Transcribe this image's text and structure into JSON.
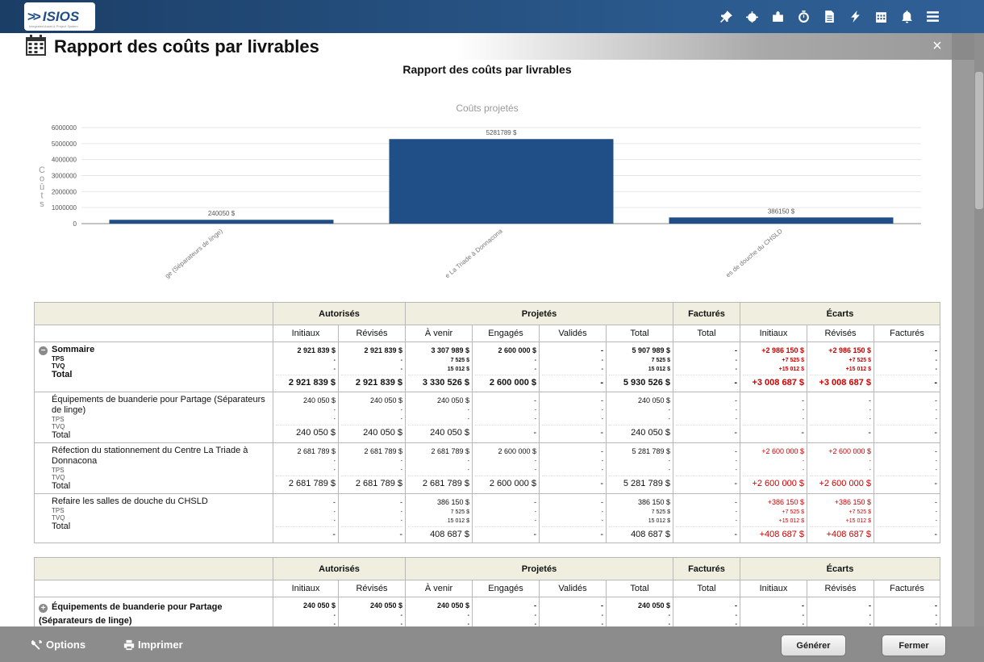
{
  "app": {
    "name": "ISIOS",
    "tagline": "Integrated Asset & Project System"
  },
  "page_title": "Rapport des coûts par livrables",
  "close_label": "×",
  "report_title": "Rapport des coûts par livrables",
  "chart_data": {
    "type": "bar",
    "title": "Coûts projetés",
    "ylabel": "Coûts",
    "ylim": [
      0,
      6000000
    ],
    "yticks": [
      "0",
      "1000000",
      "2000000",
      "3000000",
      "4000000",
      "5000000",
      "6000000"
    ],
    "categories": [
      "ge (Séparateurs de linge)",
      "e La Triade à Donnacona",
      "es de douche du CHSLD"
    ],
    "values": [
      240050,
      5281789,
      386150
    ],
    "data_labels": [
      "240050 $",
      "5281789 $",
      "386150 $"
    ],
    "bar_color": "#1f4f86"
  },
  "table_headers": {
    "groups": [
      "Autorisés",
      "Projetés",
      "Facturés",
      "Écarts"
    ],
    "cols": [
      "Initiaux",
      "Révisés",
      "À venir",
      "Engagés",
      "Validés",
      "Total",
      "Total",
      "Initiaux",
      "Révisés",
      "Facturés"
    ]
  },
  "rows": [
    {
      "name": "Sommaire",
      "sub": [
        "TPS",
        "TVQ"
      ],
      "total_label": "Total",
      "bold": true,
      "expander": "−",
      "cells": [
        {
          "v": [
            "2 921 839 $",
            "-",
            "-"
          ],
          "t": "2 921 839 $"
        },
        {
          "v": [
            "2 921 839 $",
            "-",
            "-"
          ],
          "t": "2 921 839 $"
        },
        {
          "v": [
            "3 307 989 $",
            "7 525 $",
            "15 012 $"
          ],
          "t": "3 330 526 $"
        },
        {
          "v": [
            "2 600 000 $",
            "-",
            "-"
          ],
          "t": "2 600 000 $"
        },
        {
          "v": [
            "-",
            "-",
            "-"
          ],
          "t": "-"
        },
        {
          "v": [
            "5 907 989 $",
            "7 525 $",
            "15 012 $"
          ],
          "t": "5 930 526 $"
        },
        {
          "v": [
            "-",
            "-",
            "-"
          ],
          "t": "-"
        },
        {
          "v": [
            "+2 986 150 $",
            "+7 525 $",
            "+15 012 $"
          ],
          "t": "+3 008 687 $",
          "red": true
        },
        {
          "v": [
            "+2 986 150 $",
            "+7 525 $",
            "+15 012 $"
          ],
          "t": "+3 008 687 $",
          "red": true
        },
        {
          "v": [
            "-",
            "-",
            "-"
          ],
          "t": "-"
        }
      ]
    },
    {
      "name": "Équipements de buanderie pour Partage (Séparateurs de linge)",
      "sub": [
        "TPS",
        "TVQ"
      ],
      "total_label": "Total",
      "cells": [
        {
          "v": [
            "240 050 $",
            "-",
            "-"
          ],
          "t": "240 050 $"
        },
        {
          "v": [
            "240 050 $",
            "-",
            "-"
          ],
          "t": "240 050 $"
        },
        {
          "v": [
            "240 050 $",
            "-",
            "-"
          ],
          "t": "240 050 $"
        },
        {
          "v": [
            "-",
            "-",
            "-"
          ],
          "t": "-"
        },
        {
          "v": [
            "-",
            "-",
            "-"
          ],
          "t": "-"
        },
        {
          "v": [
            "240 050 $",
            "-",
            "-"
          ],
          "t": "240 050 $"
        },
        {
          "v": [
            "-",
            "-",
            "-"
          ],
          "t": "-"
        },
        {
          "v": [
            "-",
            "-",
            "-"
          ],
          "t": "-"
        },
        {
          "v": [
            "-",
            "-",
            "-"
          ],
          "t": "-"
        },
        {
          "v": [
            "-",
            "-",
            "-"
          ],
          "t": "-"
        }
      ]
    },
    {
      "name": "Réfection du stationnement du Centre La Triade à Donnacona",
      "sub": [
        "TPS",
        "TVQ"
      ],
      "total_label": "Total",
      "cells": [
        {
          "v": [
            "2 681 789 $",
            "-",
            "-"
          ],
          "t": "2 681 789 $"
        },
        {
          "v": [
            "2 681 789 $",
            "-",
            "-"
          ],
          "t": "2 681 789 $"
        },
        {
          "v": [
            "2 681 789 $",
            "-",
            "-"
          ],
          "t": "2 681 789 $"
        },
        {
          "v": [
            "2 600 000 $",
            "-",
            "-"
          ],
          "t": "2 600 000 $"
        },
        {
          "v": [
            "-",
            "-",
            "-"
          ],
          "t": "-"
        },
        {
          "v": [
            "5 281 789 $",
            "-",
            "-"
          ],
          "t": "5 281 789 $"
        },
        {
          "v": [
            "-",
            "-",
            "-"
          ],
          "t": "-"
        },
        {
          "v": [
            "+2 600 000 $",
            "-",
            "-"
          ],
          "t": "+2 600 000 $",
          "red": true
        },
        {
          "v": [
            "+2 600 000 $",
            "-",
            "-"
          ],
          "t": "+2 600 000 $",
          "red": true
        },
        {
          "v": [
            "-",
            "-",
            "-"
          ],
          "t": "-"
        }
      ]
    },
    {
      "name": "Refaire les salles de douche du CHSLD",
      "sub": [
        "TPS",
        "TVQ"
      ],
      "total_label": "Total",
      "cells": [
        {
          "v": [
            "-",
            "-",
            "-"
          ],
          "t": "-"
        },
        {
          "v": [
            "-",
            "-",
            "-"
          ],
          "t": "-"
        },
        {
          "v": [
            "386 150 $",
            "7 525 $",
            "15 012 $"
          ],
          "t": "408 687 $"
        },
        {
          "v": [
            "-",
            "-",
            "-"
          ],
          "t": "-"
        },
        {
          "v": [
            "-",
            "-",
            "-"
          ],
          "t": "-"
        },
        {
          "v": [
            "386 150 $",
            "7 525 $",
            "15 012 $"
          ],
          "t": "408 687 $"
        },
        {
          "v": [
            "-",
            "-",
            "-"
          ],
          "t": "-"
        },
        {
          "v": [
            "+386 150 $",
            "+7 525 $",
            "+15 012 $"
          ],
          "t": "+408 687 $",
          "red": true
        },
        {
          "v": [
            "+386 150 $",
            "+7 525 $",
            "+15 012 $"
          ],
          "t": "+408 687 $",
          "red": true
        },
        {
          "v": [
            "-",
            "-",
            "-"
          ],
          "t": "-"
        }
      ]
    }
  ],
  "second_table": {
    "row": {
      "name": "Équipements de buanderie pour Partage (Séparateurs de linge)",
      "expander": "+",
      "cells": [
        "240 050 $",
        "240 050 $",
        "240 050 $",
        "-",
        "-",
        "240 050 $",
        "-",
        "-",
        "-",
        "-"
      ]
    }
  },
  "footer": {
    "options": "Options",
    "print": "Imprimer",
    "generate": "Générer",
    "close": "Fermer"
  }
}
